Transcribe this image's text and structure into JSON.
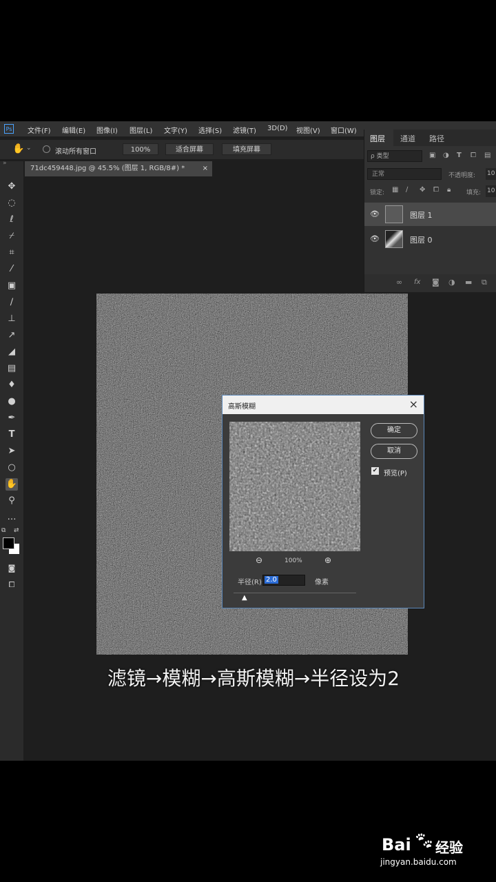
{
  "menu": [
    "文件(F)",
    "编辑(E)",
    "图像(I)",
    "图层(L)",
    "文字(Y)",
    "选择(S)",
    "滤镜(T)",
    "3D(D)",
    "视图(V)",
    "窗口(W)"
  ],
  "app_logo": "Ps",
  "options": {
    "scroll_all_windows": "滚动所有窗口",
    "zoom": "100%",
    "fit_screen": "适合屏幕",
    "fill_screen": "填充屏幕"
  },
  "document_tab": {
    "title": "71dc459448.jpg @ 45.5% (图层 1, RGB/8#) *",
    "close": "×"
  },
  "layers_panel": {
    "tabs": [
      "图层",
      "通道",
      "路径"
    ],
    "kind_filter": "ρ 类型",
    "blend_mode": "正常",
    "opacity_label": "不透明度:",
    "opacity_value": "10",
    "lock_label": "锁定:",
    "fill_label": "填充:",
    "fill_value": "10",
    "layers": [
      {
        "name": "图层 1",
        "selected": true
      },
      {
        "name": "图层 0",
        "selected": false
      }
    ],
    "footer_icons": [
      "link-icon",
      "fx-icon",
      "mask-icon",
      "adjustment-icon",
      "folder-icon",
      "new-layer-icon"
    ]
  },
  "dialog": {
    "title": "高斯模糊",
    "close": "×",
    "ok": "确定",
    "cancel": "取消",
    "preview_label": "预览(P)",
    "preview_checked": true,
    "zoom": "100%",
    "radius_label": "半径(R):",
    "radius_value": "2.0",
    "unit": "像素"
  },
  "caption": "滤镜→模糊→高斯模糊→半径设为2",
  "watermark": {
    "brand_left": "Bai",
    "brand_right": "经验",
    "url": "jingyan.baidu.com"
  },
  "colors": {
    "accent": "#2b6cd6",
    "app_bg": "#1e1e1e",
    "panel_bg": "#323232"
  }
}
